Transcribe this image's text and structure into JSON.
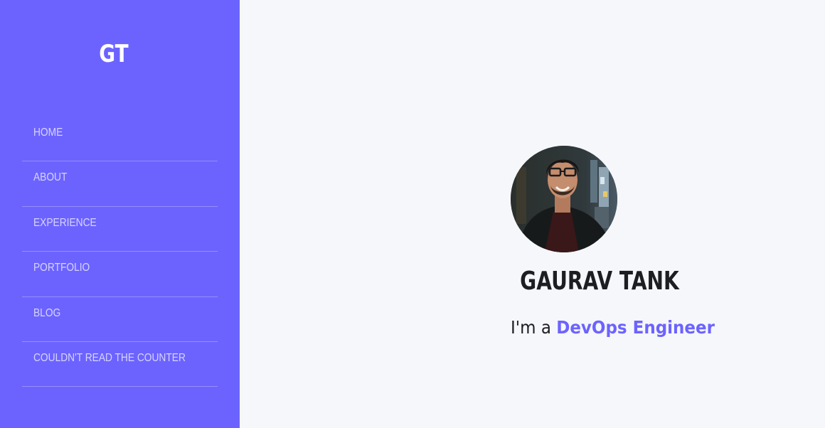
{
  "sidebar": {
    "logo": "GT",
    "nav_items": [
      {
        "label": "HOME"
      },
      {
        "label": "ABOUT"
      },
      {
        "label": "EXPERIENCE"
      },
      {
        "label": "PORTFOLIO"
      },
      {
        "label": "BLOG"
      },
      {
        "label": "COULDN'T READ THE COUNTER"
      }
    ]
  },
  "hero": {
    "name": "GAURAV TANK",
    "tagline_prefix": "I'm a ",
    "role": "DevOps Engineer"
  },
  "colors": {
    "accent": "#6c63ff",
    "background": "#f6f7fa",
    "text": "#1d1e22"
  }
}
